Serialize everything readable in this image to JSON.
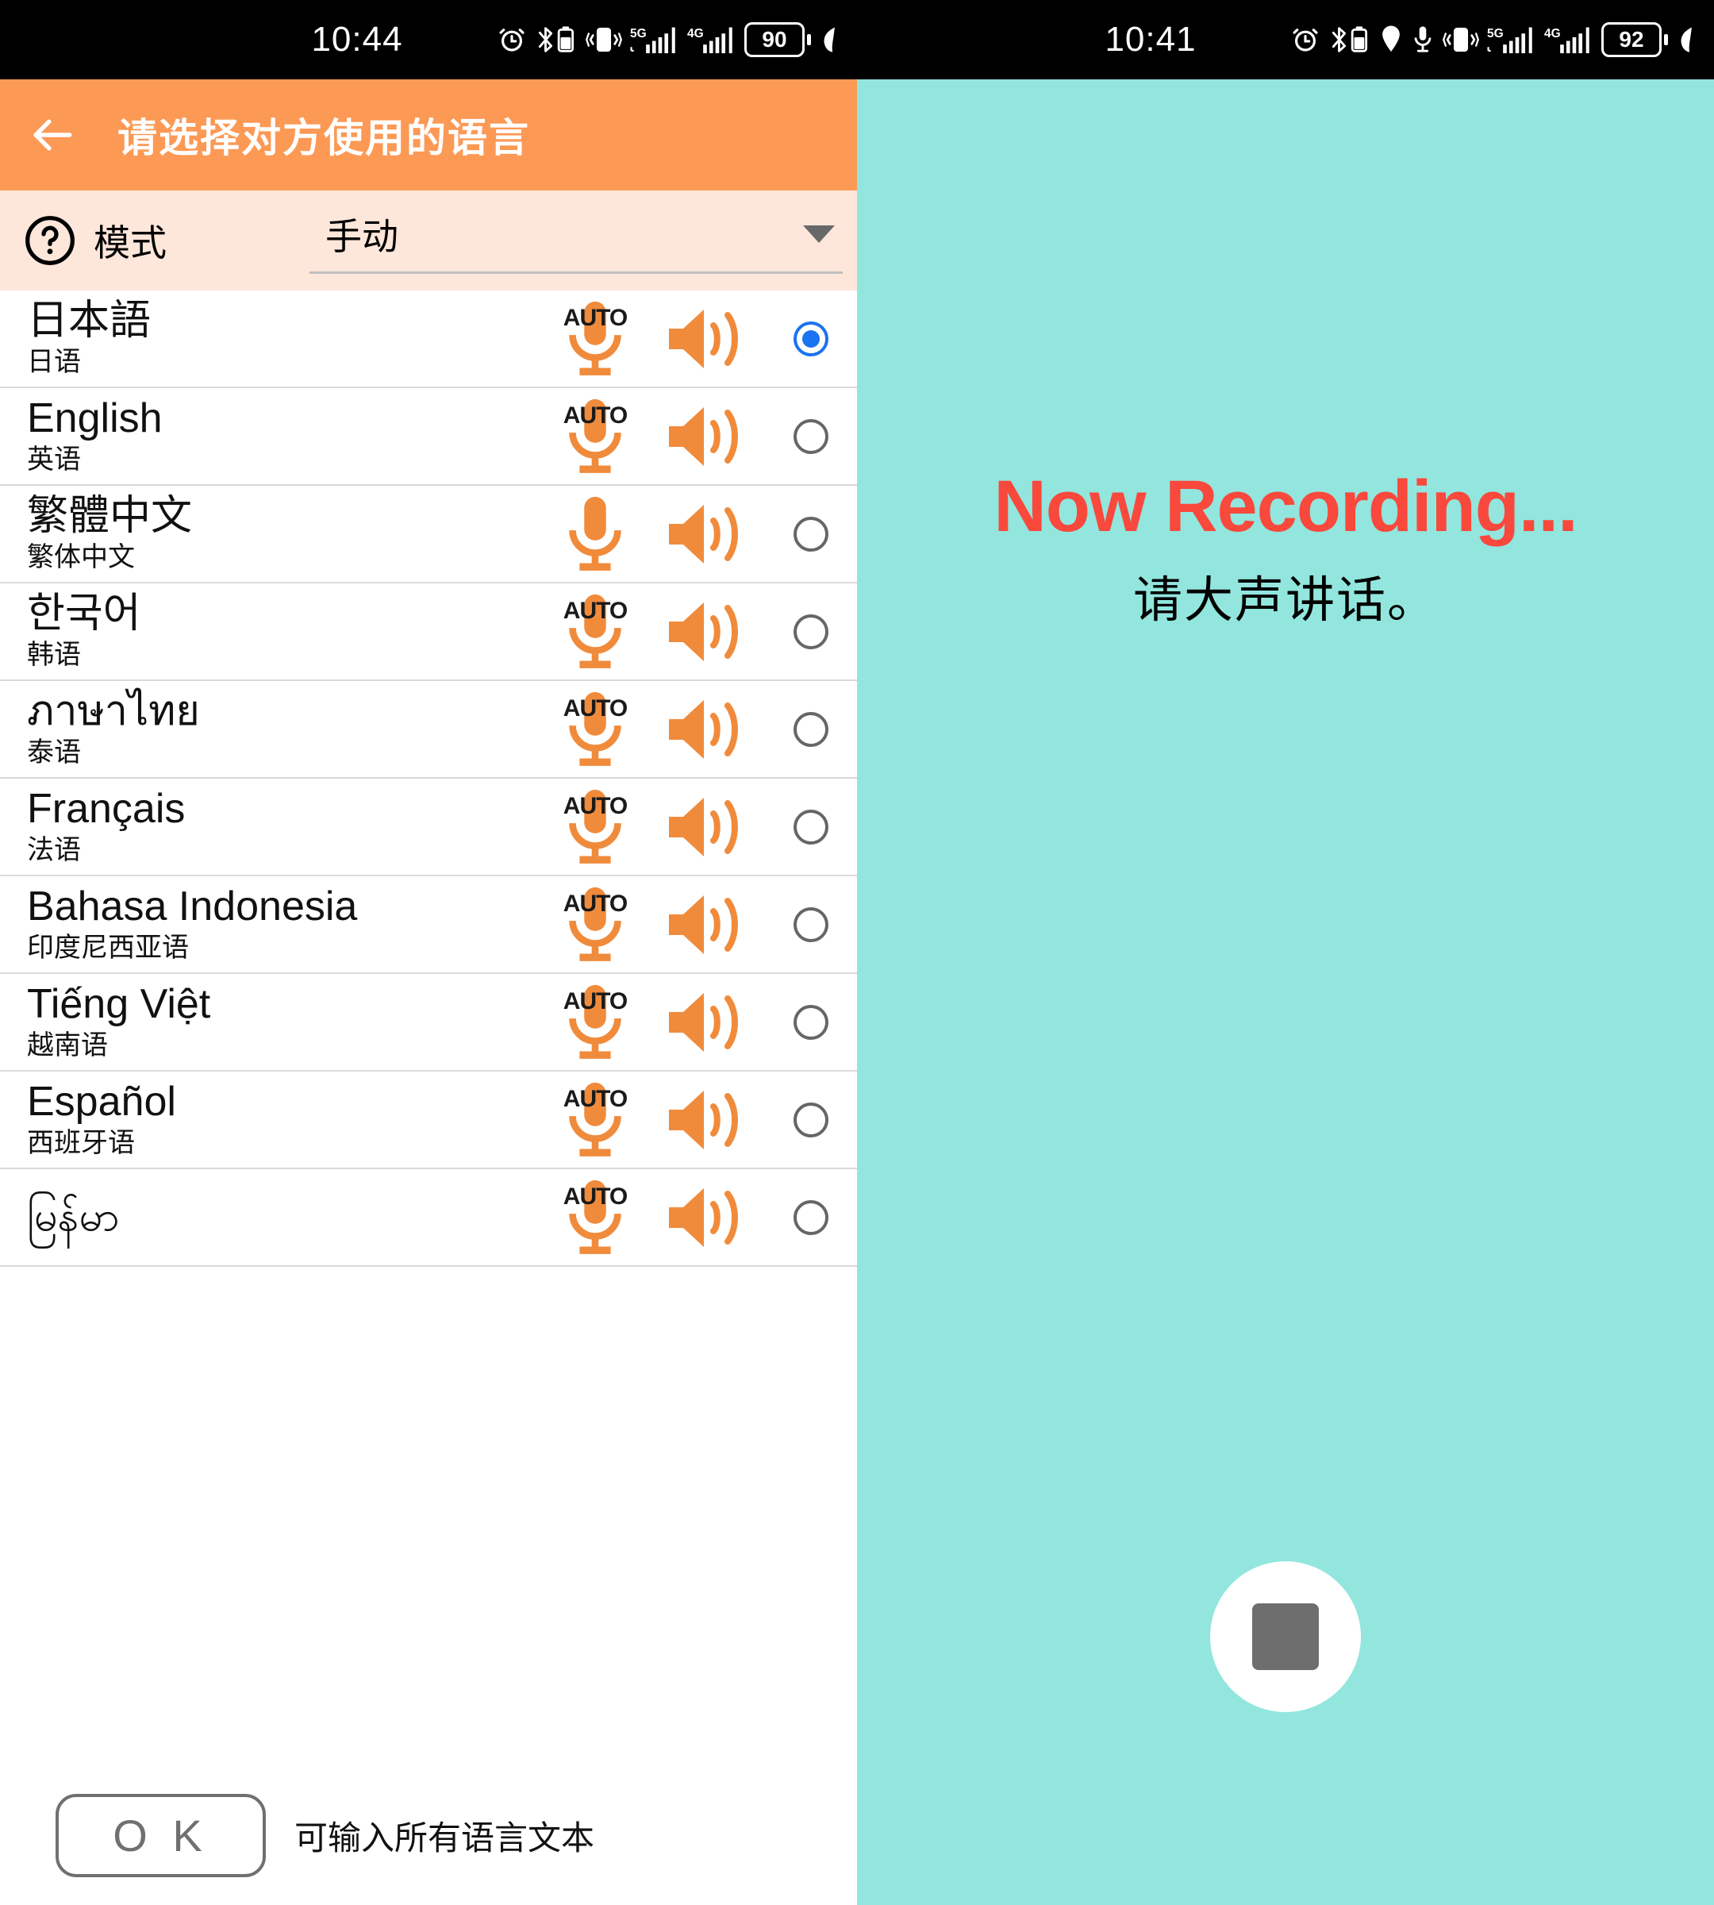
{
  "left": {
    "status_bar": {
      "time": "10:44",
      "battery_percent": "90",
      "icons": [
        "alarm-icon",
        "bluetooth-battery-icon",
        "vibrate-icon",
        "signal-5g-icon",
        "signal-4g-icon",
        "battery-icon",
        "power-saving-icon"
      ]
    },
    "appbar": {
      "back_icon": "back-arrow-icon",
      "title": "请选择对方使用的语言"
    },
    "modebar": {
      "help_icon": "help-circle-icon",
      "label": "模式",
      "value": "手动",
      "caret_icon": "chevron-down-icon",
      "options": [
        "手动"
      ]
    },
    "languages": [
      {
        "native": "日本語",
        "chinese": "日语",
        "auto": "AUTO",
        "selected": true
      },
      {
        "native": "English",
        "chinese": "英语",
        "auto": "AUTO",
        "selected": false
      },
      {
        "native": "繁體中文",
        "chinese": "繁体中文",
        "auto": "",
        "selected": false
      },
      {
        "native": "한국어",
        "chinese": "韩语",
        "auto": "AUTO",
        "selected": false
      },
      {
        "native": "ภาษาไทย",
        "chinese": "泰语",
        "auto": "AUTO",
        "selected": false
      },
      {
        "native": "Français",
        "chinese": "法语",
        "auto": "AUTO",
        "selected": false
      },
      {
        "native": "Bahasa Indonesia",
        "chinese": "印度尼西亚语",
        "auto": "AUTO",
        "selected": false
      },
      {
        "native": "Tiếng Việt",
        "chinese": "越南语",
        "auto": "AUTO",
        "selected": false
      },
      {
        "native": "Español",
        "chinese": "西班牙语",
        "auto": "AUTO",
        "selected": false
      },
      {
        "native": "မြန်မာ",
        "chinese": "",
        "auto": "AUTO",
        "selected": false
      }
    ],
    "footer": {
      "ok_label": "O K",
      "hint": "可输入所有语言文本"
    }
  },
  "right": {
    "status_bar": {
      "time": "10:41",
      "battery_percent": "92",
      "icons": [
        "alarm-icon",
        "bluetooth-battery-icon",
        "location-icon",
        "mic-icon",
        "vibrate-icon",
        "signal-5g-icon",
        "signal-4g-icon",
        "battery-icon",
        "power-saving-icon"
      ]
    },
    "recording": {
      "title": "Now Recording...",
      "subtitle": "请大声讲话。",
      "stop_button_icon": "stop-square-icon"
    }
  },
  "colors": {
    "appbar_orange": "#fc9955",
    "modebar_peach": "#fde6da",
    "mic_orange": "#f08b3c",
    "recording_teal": "#92e6de",
    "recording_red": "#f9483c",
    "radio_blue": "#1a73f0",
    "stop_gray": "#6e6e6e"
  }
}
